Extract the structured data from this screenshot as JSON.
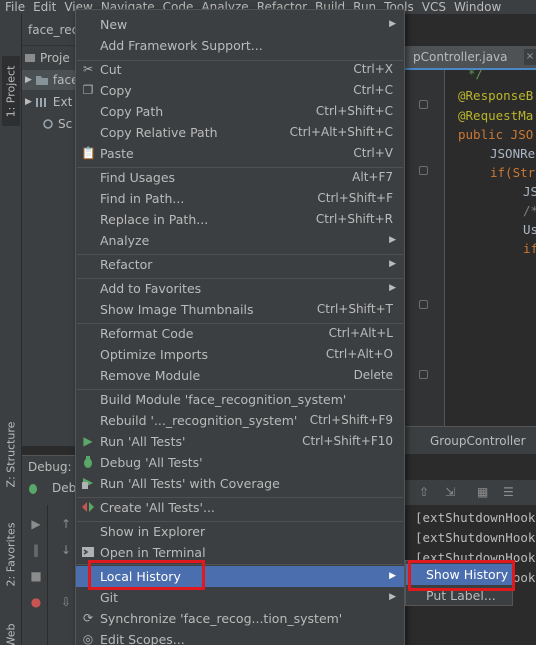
{
  "menubar": [
    "File",
    "Edit",
    "View",
    "Navigate",
    "Code",
    "Analyze",
    "Refactor",
    "Build",
    "Run",
    "Tools",
    "VCS",
    "Window"
  ],
  "breadcrumb": "face_reco",
  "left_stripe": {
    "project": "1: Project",
    "structure": "Z: Structure",
    "favorites": "2: Favorites",
    "web": "Web"
  },
  "project_tree": [
    {
      "label": "Proje",
      "icon": "project-icon"
    },
    {
      "label": "face",
      "icon": "folder-icon"
    },
    {
      "label": "Ext",
      "icon": "library-icon"
    },
    {
      "label": "Sc",
      "icon": "scratches-icon"
    }
  ],
  "debug": {
    "header": "Debug:",
    "tab": "Deb"
  },
  "editor": {
    "tab_label": "pController.java",
    "close_glyph": "×",
    "bottom_label": "GroupController",
    "code_lines": [
      {
        "text": "*/",
        "color": "#629755"
      },
      {
        "text": "@ResponseB",
        "color": "#bbb529"
      },
      {
        "text": "@RequestMa",
        "color": "#bbb529"
      },
      {
        "text": "public JSO",
        "color": "#cc7832"
      },
      {
        "text": "JSONRe",
        "color": "#a9b7c6"
      },
      {
        "text": "if(Str",
        "color": "#cc7832"
      },
      {
        "text": "JS",
        "color": "#a9b7c6"
      },
      {
        "text": "/*",
        "color": "#808080"
      },
      {
        "text": "Us",
        "color": "#a9b7c6"
      },
      {
        "text": "if",
        "color": "#cc7832"
      }
    ]
  },
  "console_lines": [
    "[extShutdownHook",
    "[extShutdownHook",
    "[extShutdownHook",
    "[extShutdownHook"
  ],
  "context_menu": {
    "items": [
      {
        "label": "New",
        "shortcut": "",
        "icon": "",
        "submenu": true
      },
      {
        "label": "Add Framework Support...",
        "shortcut": "",
        "icon": "",
        "submenu": false
      },
      {
        "label": "Cut",
        "shortcut": "Ctrl+X",
        "icon": "scissors-icon",
        "submenu": false
      },
      {
        "label": "Copy",
        "shortcut": "Ctrl+C",
        "icon": "copy-icon",
        "submenu": false
      },
      {
        "label": "Copy Path",
        "shortcut": "Ctrl+Shift+C",
        "icon": "",
        "submenu": false
      },
      {
        "label": "Copy Relative Path",
        "shortcut": "Ctrl+Alt+Shift+C",
        "icon": "",
        "submenu": false
      },
      {
        "label": "Paste",
        "shortcut": "Ctrl+V",
        "icon": "paste-icon",
        "submenu": false
      },
      {
        "label": "Find Usages",
        "shortcut": "Alt+F7",
        "icon": "",
        "submenu": false
      },
      {
        "label": "Find in Path...",
        "shortcut": "Ctrl+Shift+F",
        "icon": "",
        "submenu": false
      },
      {
        "label": "Replace in Path...",
        "shortcut": "Ctrl+Shift+R",
        "icon": "",
        "submenu": false
      },
      {
        "label": "Analyze",
        "shortcut": "",
        "icon": "",
        "submenu": true
      },
      {
        "label": "Refactor",
        "shortcut": "",
        "icon": "",
        "submenu": true
      },
      {
        "label": "Add to Favorites",
        "shortcut": "",
        "icon": "",
        "submenu": true
      },
      {
        "label": "Show Image Thumbnails",
        "shortcut": "Ctrl+Shift+T",
        "icon": "",
        "submenu": false
      },
      {
        "label": "Reformat Code",
        "shortcut": "Ctrl+Alt+L",
        "icon": "",
        "submenu": false
      },
      {
        "label": "Optimize Imports",
        "shortcut": "Ctrl+Alt+O",
        "icon": "",
        "submenu": false
      },
      {
        "label": "Remove Module",
        "shortcut": "Delete",
        "icon": "",
        "submenu": false
      },
      {
        "label": "Build Module 'face_recognition_system'",
        "shortcut": "",
        "icon": "",
        "submenu": false
      },
      {
        "label": "Rebuild '..._recognition_system'",
        "shortcut": "Ctrl+Shift+F9",
        "icon": "",
        "submenu": false
      },
      {
        "label": "Run 'All Tests'",
        "shortcut": "Ctrl+Shift+F10",
        "icon": "run-icon",
        "submenu": false
      },
      {
        "label": "Debug 'All Tests'",
        "shortcut": "",
        "icon": "debug-icon",
        "submenu": false
      },
      {
        "label": "Run 'All Tests' with Coverage",
        "shortcut": "",
        "icon": "coverage-icon",
        "submenu": false
      },
      {
        "label": "Create 'All Tests'...",
        "shortcut": "",
        "icon": "create-config-icon",
        "submenu": false
      },
      {
        "label": "Show in Explorer",
        "shortcut": "",
        "icon": "",
        "submenu": false
      },
      {
        "label": "Open in Terminal",
        "shortcut": "",
        "icon": "terminal-icon",
        "submenu": false
      },
      {
        "label": "Local History",
        "shortcut": "",
        "icon": "",
        "submenu": true,
        "selected": true
      },
      {
        "label": "Git",
        "shortcut": "",
        "icon": "",
        "submenu": true
      },
      {
        "label": "Synchronize 'face_recog...tion_system'",
        "shortcut": "",
        "icon": "sync-icon",
        "submenu": false
      },
      {
        "label": "Edit Scopes...",
        "shortcut": "",
        "icon": "scopes-icon",
        "submenu": false
      }
    ]
  },
  "submenu": {
    "items": [
      {
        "label": "Show History",
        "selected": true
      },
      {
        "label": "Put Label..."
      }
    ]
  },
  "colors": {
    "menu_bg": "#3c3f41",
    "selection": "#4b6eaf",
    "highlight_box": "#e0191f"
  }
}
